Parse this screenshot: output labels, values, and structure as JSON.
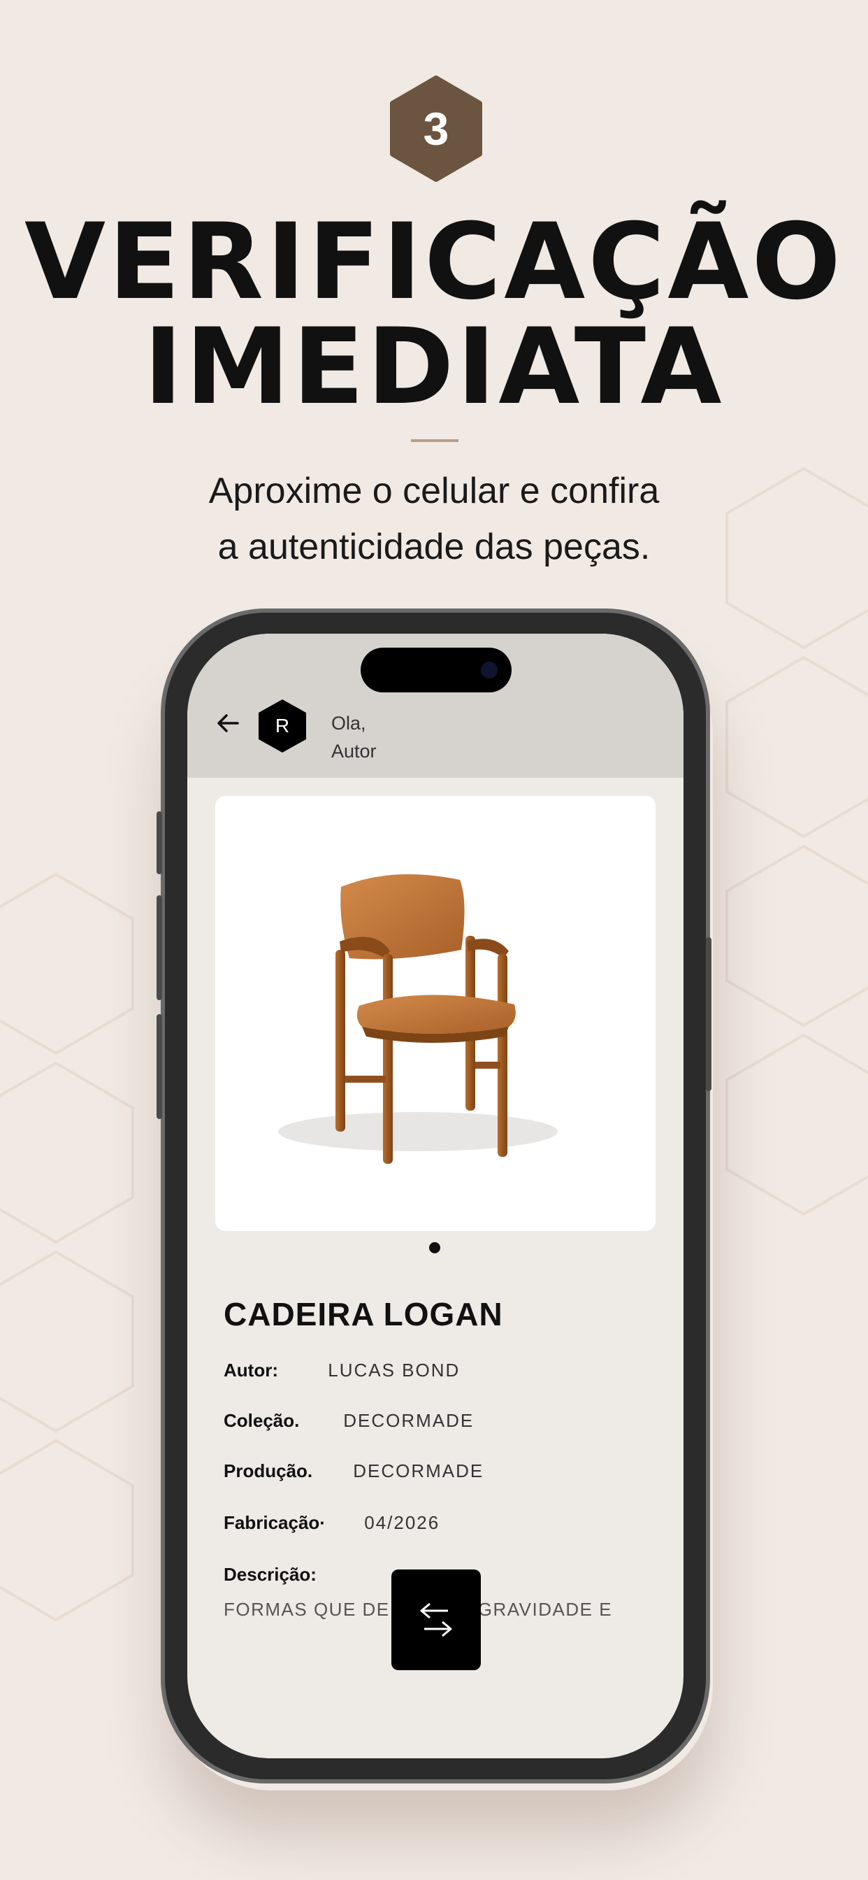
{
  "step": {
    "number": "3"
  },
  "headline": {
    "line1": "VERIFICAÇÃO",
    "line2": "IMEDIATA"
  },
  "subtitle": {
    "line1": "Aproxime o celular e confira",
    "line2": "a autenticidade das peças."
  },
  "colors": {
    "background": "#f1e9e3",
    "badge": "#6b5540",
    "divider": "#b79f8a",
    "header": "#d6d3cf",
    "screen": "#eeebe7"
  },
  "app": {
    "header": {
      "back_icon": "arrow-left-icon",
      "avatar_letter": "R",
      "greeting_line1": "Ola,",
      "greeting_line2": "Autor"
    },
    "product": {
      "image": "chair-image",
      "name": "CADEIRA LOGAN",
      "specs": [
        {
          "label": "Autor:",
          "value": "LUCAS BOND"
        },
        {
          "label": "Coleção.",
          "value": "DECORMADE"
        },
        {
          "label": "Produção.",
          "value": "DECORMADE"
        },
        {
          "label": "Fabricação·",
          "value": "04/2026"
        }
      ],
      "description_label": "Descrição:",
      "description_text": "FORMAS QUE DE",
      "description_text_2": "A GRAVIDADE E"
    },
    "pager": {
      "current": 1,
      "total": 1
    },
    "nfc_icon": "swap-arrows-icon"
  }
}
